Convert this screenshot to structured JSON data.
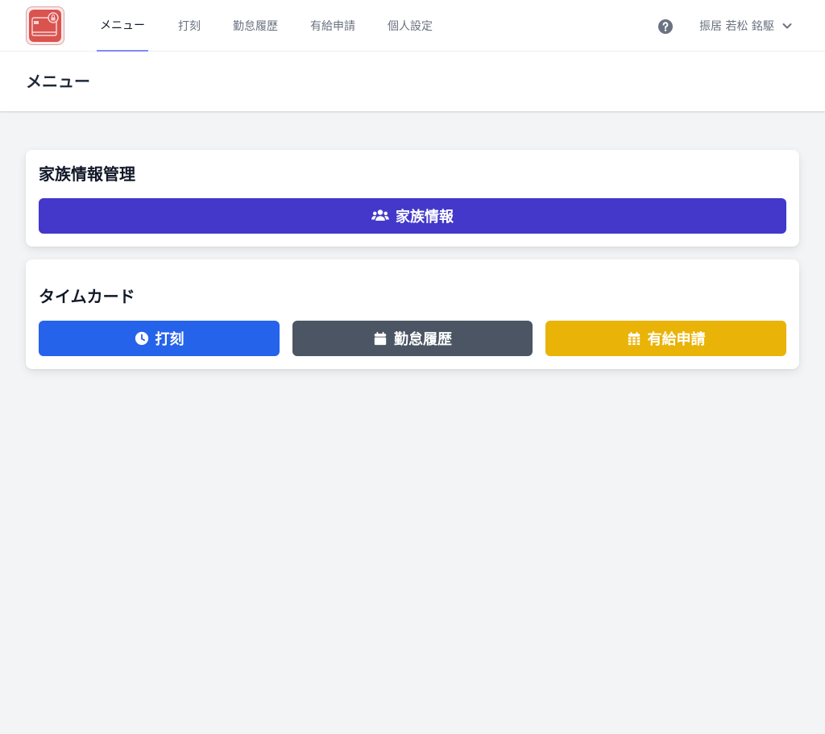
{
  "nav": {
    "logo_icon": "timecard-lock-logo-icon",
    "items": [
      {
        "label": "メニュー",
        "active": true
      },
      {
        "label": "打刻",
        "active": false
      },
      {
        "label": "勤怠履歴",
        "active": false
      },
      {
        "label": "有給申請",
        "active": false
      },
      {
        "label": "個人設定",
        "active": false
      }
    ],
    "help_icon": "question-circle-icon",
    "user_name": "振居 若松 銘駆",
    "user_dropdown_icon": "chevron-down-icon"
  },
  "page": {
    "title": "メニュー"
  },
  "family_card": {
    "title": "家族情報管理",
    "button": {
      "label": "家族情報",
      "icon": "users-icon",
      "color": "#4338ca"
    }
  },
  "timecard_card": {
    "title": "タイムカード",
    "buttons": [
      {
        "label": "打刻",
        "icon": "clock-icon",
        "color": "#2563eb"
      },
      {
        "label": "勤怠履歴",
        "icon": "calendar-icon",
        "color": "#4b5563"
      },
      {
        "label": "有給申請",
        "icon": "calendar-grid-icon",
        "color": "#eab308"
      }
    ]
  },
  "colors": {
    "background": "#f3f4f6",
    "active_underline": "#818cf8",
    "nav_text": "#6b7280"
  }
}
